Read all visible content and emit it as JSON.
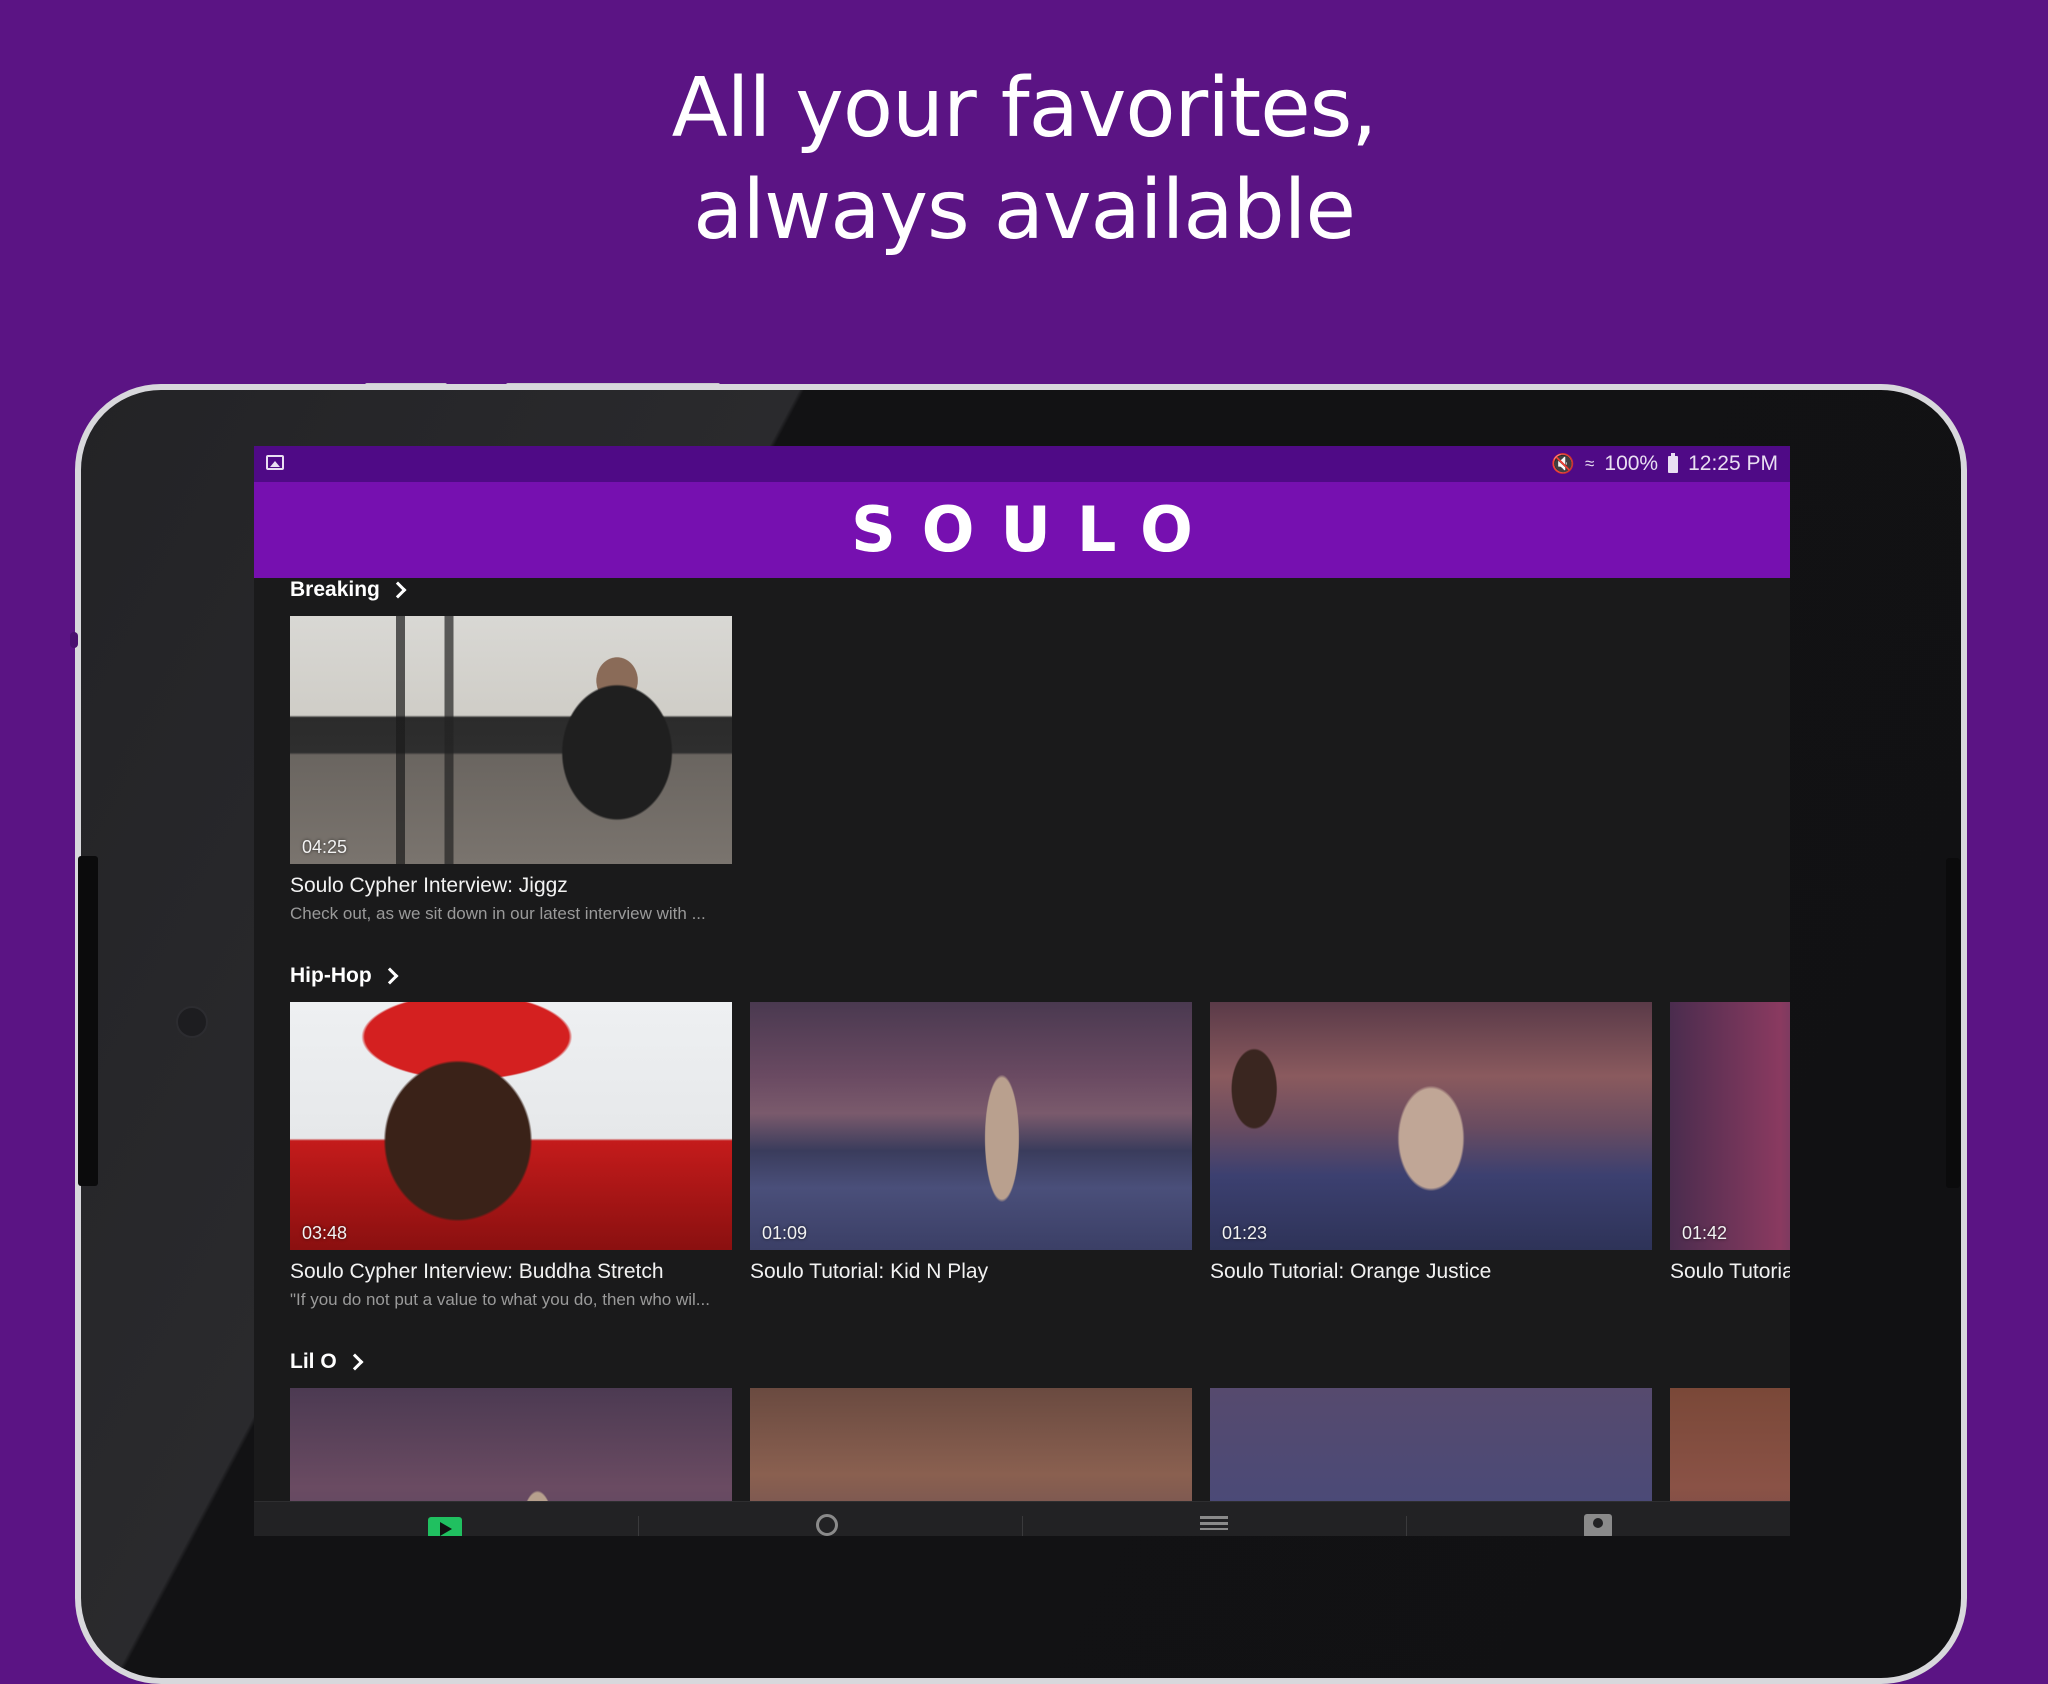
{
  "headline": {
    "line1": "All your favorites,",
    "line2": "always available"
  },
  "status_bar": {
    "left_icon": "image-notification-icon",
    "icons": [
      "mute-icon",
      "wifi-icon",
      "battery-icon"
    ],
    "battery": "100%",
    "time": "12:25 PM"
  },
  "app": {
    "logo": "SOULO",
    "colors": {
      "header": "#7610b0",
      "status_bar": "#4f0a86",
      "background": "#1a1a1b",
      "page": "#5b1484"
    }
  },
  "sections": [
    {
      "title": "Breaking",
      "videos": [
        {
          "duration": "04:25",
          "title": "Soulo Cypher Interview: Jiggz",
          "description": "Check out, as we sit down in our latest interview with ..."
        }
      ]
    },
    {
      "title": "Hip-Hop",
      "videos": [
        {
          "duration": "03:48",
          "title": "Soulo Cypher Interview: Buddha Stretch",
          "description": "\"If you do not put a value to what you do, then who wil..."
        },
        {
          "duration": "01:09",
          "title": "Soulo Tutorial: Kid N Play",
          "description": ""
        },
        {
          "duration": "01:23",
          "title": "Soulo Tutorial: Orange Justice",
          "description": ""
        },
        {
          "duration": "01:42",
          "title": "Soulo Tutoria",
          "description": ""
        }
      ]
    },
    {
      "title": "Lil O",
      "videos": []
    }
  ],
  "bottom_nav": {
    "tabs": [
      "play-icon",
      "search-icon",
      "menu-icon",
      "profile-icon"
    ],
    "active": "play-icon"
  }
}
